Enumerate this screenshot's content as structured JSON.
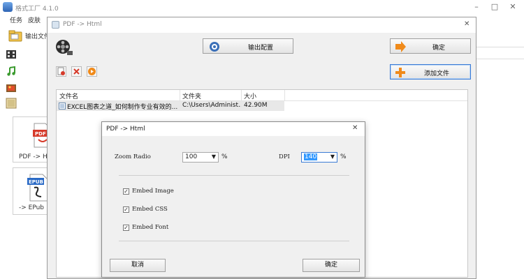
{
  "app": {
    "title": "格式工厂 4.1.0",
    "menu": [
      "任务",
      "皮肤"
    ],
    "output_folder_label": "输出文件",
    "cards": [
      {
        "label": "PDF -> H"
      },
      {
        "label": "-> EPub"
      }
    ]
  },
  "pdf_dialog": {
    "title": "PDF -> Html",
    "output_config_label": "输出配置",
    "ok_label": "确定",
    "add_file_label": "添加文件",
    "list_headers": [
      "文件名",
      "文件夹",
      "大小"
    ],
    "files": [
      {
        "name": "EXCEL图表之道_如何制作专业有效的...",
        "folder": "C:\\Users\\Administ...",
        "size": "42.90M"
      }
    ]
  },
  "config_dialog": {
    "title": "PDF -> Html",
    "zoom_label": "Zoom Radio",
    "zoom_value": "100",
    "zoom_unit": "%",
    "dpi_label": "DPI",
    "dpi_value": "140",
    "dpi_unit": "%",
    "options": [
      {
        "label": "Embed Image",
        "checked": true
      },
      {
        "label": "Embed CSS",
        "checked": true
      },
      {
        "label": "Embed Font",
        "checked": true
      }
    ],
    "check_mark": "✓",
    "cancel_label": "取消",
    "ok_label": "确定"
  },
  "colors": {
    "accent": "#3a7bd5",
    "highlight": "#3399ff",
    "orange": "#f08a1a"
  }
}
